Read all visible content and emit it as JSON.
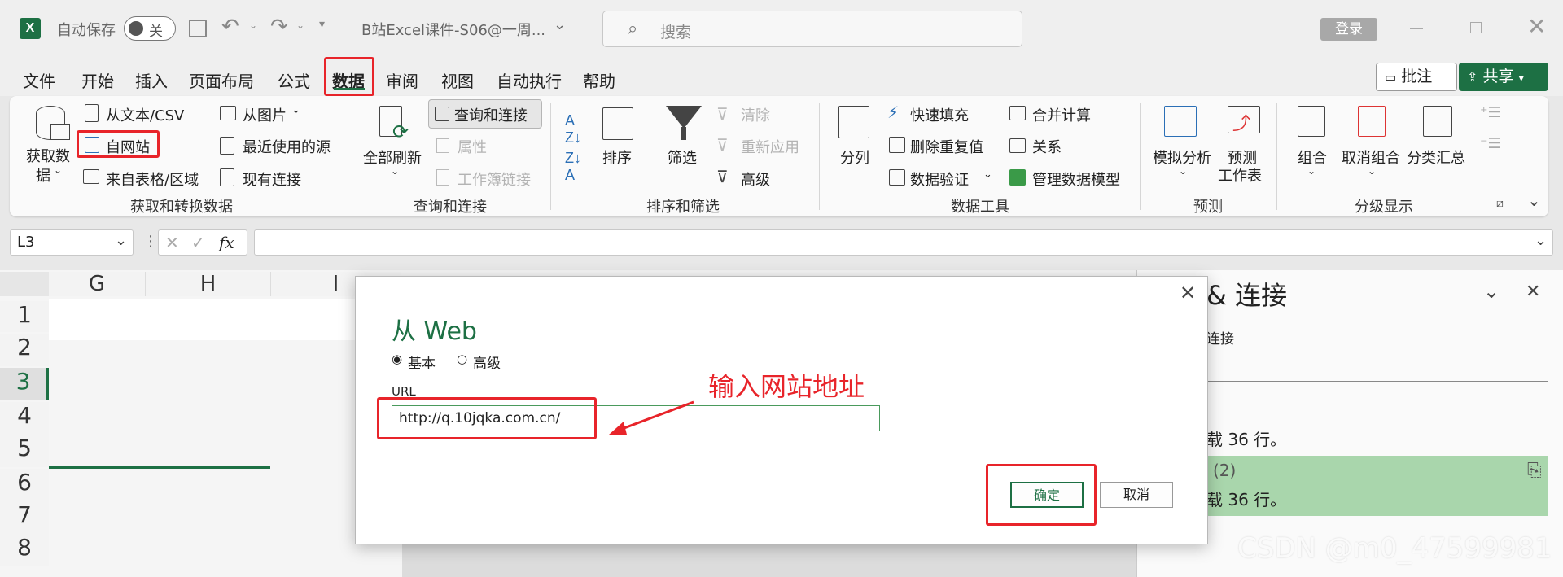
{
  "app": {
    "autosave_label": "自动保存",
    "autosave_state": "关",
    "file_title": "B站Excel课件-S06@一周...",
    "search_placeholder": "搜索",
    "login_label": "登录"
  },
  "menu": {
    "items": [
      "文件",
      "开始",
      "插入",
      "页面布局",
      "公式",
      "数据",
      "审阅",
      "视图",
      "自动执行",
      "帮助"
    ],
    "active": "数据",
    "comment_label": "批注",
    "share_label": "共享"
  },
  "ribbon": {
    "get_data": {
      "big_label_1": "获取数",
      "big_label_2": "据",
      "from_text": "从文本/CSV",
      "from_web": "自网站",
      "from_table": "来自表格/区域",
      "from_picture": "从图片",
      "recent_sources": "最近使用的源",
      "existing_conn": "现有连接",
      "group": "获取和转换数据"
    },
    "queries": {
      "refresh_all": "全部刷新",
      "queries_conn": "查询和连接",
      "properties": "属性",
      "workbook_links": "工作簿链接",
      "group": "查询和连接"
    },
    "sort_filter": {
      "sort": "排序",
      "filter": "筛选",
      "clear": "清除",
      "reapply": "重新应用",
      "advanced": "高级",
      "group": "排序和筛选"
    },
    "data_tools": {
      "text_to_columns": "分列",
      "flash_fill": "快速填充",
      "remove_dup": "删除重复值",
      "data_validation": "数据验证",
      "consolidate": "合并计算",
      "relationships": "关系",
      "manage_model": "管理数据模型",
      "group": "数据工具"
    },
    "forecast": {
      "what_if": "模拟分析",
      "forecast_sheet_1": "预测",
      "forecast_sheet_2": "工作表",
      "group": "预测"
    },
    "outline": {
      "group_btn": "组合",
      "ungroup": "取消组合",
      "subtotal": "分类汇总",
      "group": "分级显示"
    }
  },
  "formula_bar": {
    "name_box": "L3",
    "fx": "fx"
  },
  "sheet": {
    "columns": [
      "G",
      "H",
      "I"
    ],
    "rows": [
      "1",
      "2",
      "3",
      "4",
      "5",
      "6",
      "7",
      "8"
    ]
  },
  "side_pane": {
    "title": "& 连接",
    "tab": "连接",
    "item1_status": "载 36 行。",
    "item2_name": "(2)",
    "item2_status": "载 36 行。"
  },
  "dialog": {
    "title": "从 Web",
    "radio_basic": "基本",
    "radio_advanced": "高级",
    "url_label": "URL",
    "url_value": "http://q.10jqka.com.cn/",
    "ok": "确定",
    "cancel": "取消"
  },
  "annotation": {
    "text": "输入网站地址"
  },
  "watermark": "CSDN @m0_47599981"
}
